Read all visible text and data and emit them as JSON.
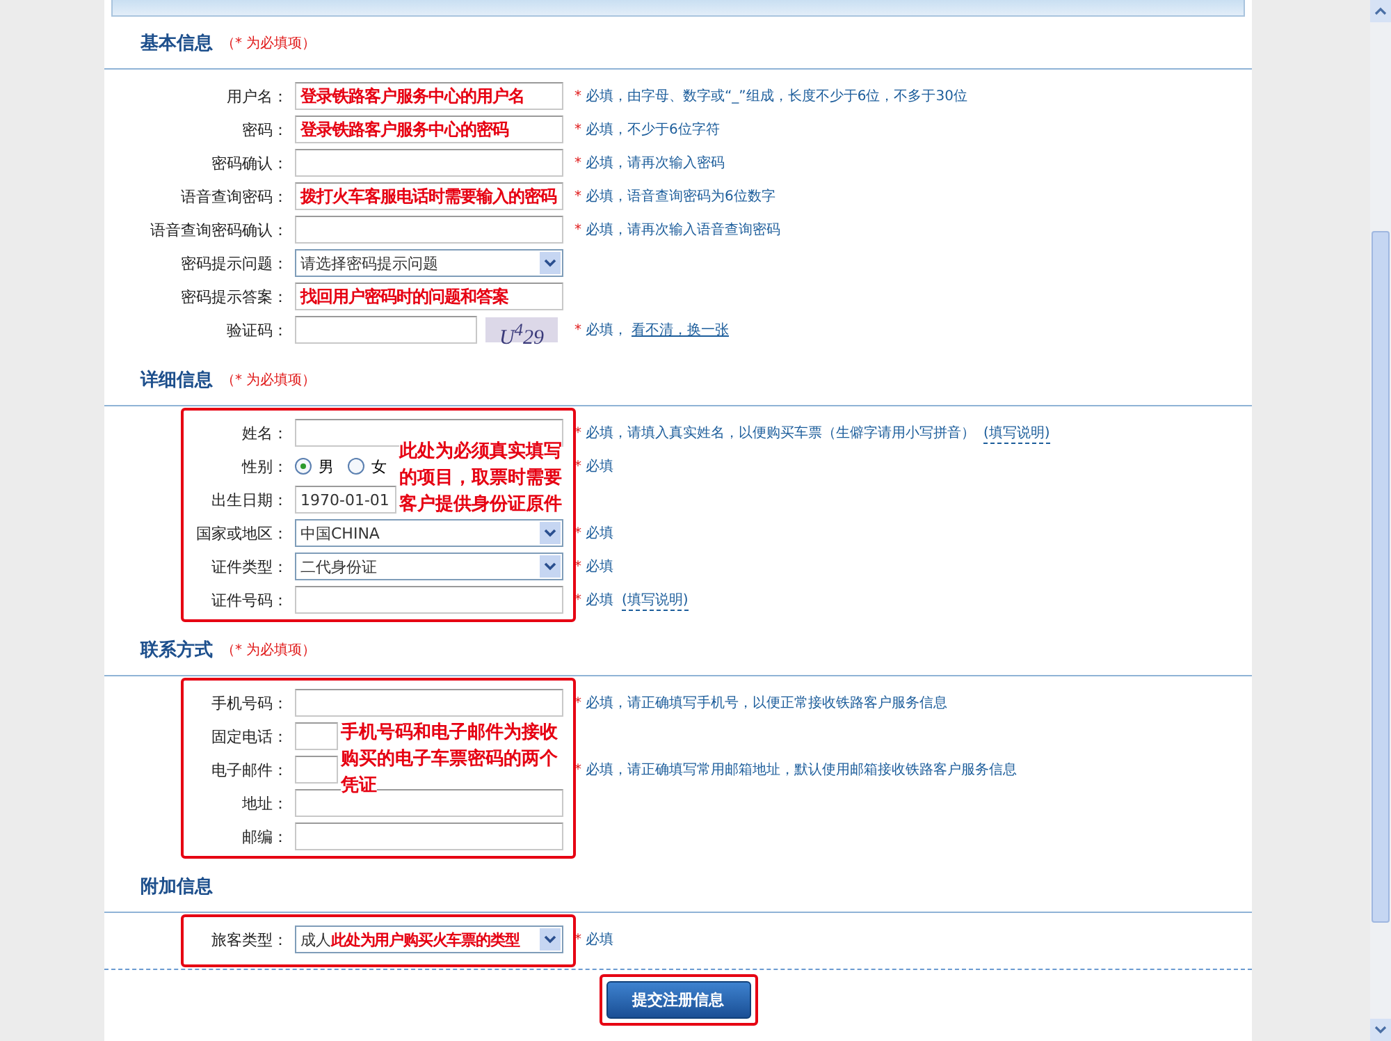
{
  "sections": [
    {
      "title": "基本信息",
      "note": "（* 为必填项）",
      "rows": [
        {
          "kind": "text",
          "label": "用户名：",
          "annotation": "登录铁路客户服务中心的用户名",
          "mark": "*",
          "hint": "必填，由字母、数字或“_”组成，长度不少于6位，不多于30位"
        },
        {
          "kind": "text",
          "label": "密码：",
          "annotation": "登录铁路客户服务中心的密码",
          "mark": "*",
          "hint": "必填，不少于6位字符"
        },
        {
          "kind": "text",
          "label": "密码确认：",
          "mark": "*",
          "hint": "必填，请再次输入密码"
        },
        {
          "kind": "text",
          "label": "语音查询密码：",
          "annotation": "拨打火车客服电话时需要输入的密码",
          "mark": "*",
          "hint": "必填，语音查询密码为6位数字"
        },
        {
          "kind": "text",
          "label": "语音查询密码确认：",
          "mark": "*",
          "hint": "必填，请再次输入语音查询密码"
        },
        {
          "kind": "select",
          "label": "密码提示问题：",
          "value": "请选择密码提示问题"
        },
        {
          "kind": "text",
          "label": "密码提示答案：",
          "annotation": "找回用户密码时的问题和答案"
        },
        {
          "kind": "captcha",
          "label": "验证码：",
          "captcha": "U$^{4}$29",
          "mark": "*",
          "hint": "必填，",
          "link": "看不清，换一张"
        }
      ]
    },
    {
      "title": "详细信息",
      "note": "（* 为必填项）",
      "outlined": true,
      "callout": [
        "此处为必须真实填写",
        "的项目，取票时需要",
        "客户提供身份证原件"
      ],
      "rows": [
        {
          "kind": "text",
          "label": "姓名：",
          "mark": "*",
          "hint": "必填，请填入真实姓名，以便购买车票（生僻字请用小写拼音）",
          "link": "(填写说明)"
        },
        {
          "kind": "radio",
          "label": "性别：",
          "options": [
            {
              "label": "男",
              "selected": true
            },
            {
              "label": "女",
              "selected": false
            }
          ],
          "mark": "*",
          "hint": "必填"
        },
        {
          "kind": "text",
          "label": "出生日期：",
          "value": "1970-01-01"
        },
        {
          "kind": "select",
          "label": "国家或地区：",
          "value": "中国CHINA",
          "mark": "*",
          "hint": "必填"
        },
        {
          "kind": "select",
          "label": "证件类型：",
          "value": "二代身份证",
          "mark": "*",
          "hint": "必填"
        },
        {
          "kind": "text",
          "label": "证件号码：",
          "mark": "*",
          "hint": "必填",
          "link": "(填写说明)"
        }
      ]
    },
    {
      "title": "联系方式",
      "note": "（* 为必填项）",
      "outlined": true,
      "callout": [
        "手机号码和电子邮件为接收",
        "购买的电子车票密码的两个",
        "凭证"
      ],
      "rows": [
        {
          "kind": "text",
          "label": "手机号码：",
          "mark": "*",
          "hint": "必填，请正确填写手机号，以便正常接收铁路客户服务信息"
        },
        {
          "kind": "text",
          "label": "固定电话："
        },
        {
          "kind": "text",
          "label": "电子邮件：",
          "mark": "*",
          "hint": "必填，请正确填写常用邮箱地址，默认使用邮箱接收铁路客户服务信息"
        },
        {
          "kind": "text",
          "label": "地址："
        },
        {
          "kind": "text",
          "label": "邮编："
        }
      ]
    },
    {
      "title": "附加信息",
      "outlined": true,
      "rows": [
        {
          "kind": "select",
          "label": "旅客类型：",
          "value": "成人",
          "annotation": "此处为用户购买火车票的类型",
          "mark": "*",
          "hint": "必填"
        }
      ]
    }
  ],
  "submit": {
    "label": "提交注册信息",
    "outlined": true
  }
}
